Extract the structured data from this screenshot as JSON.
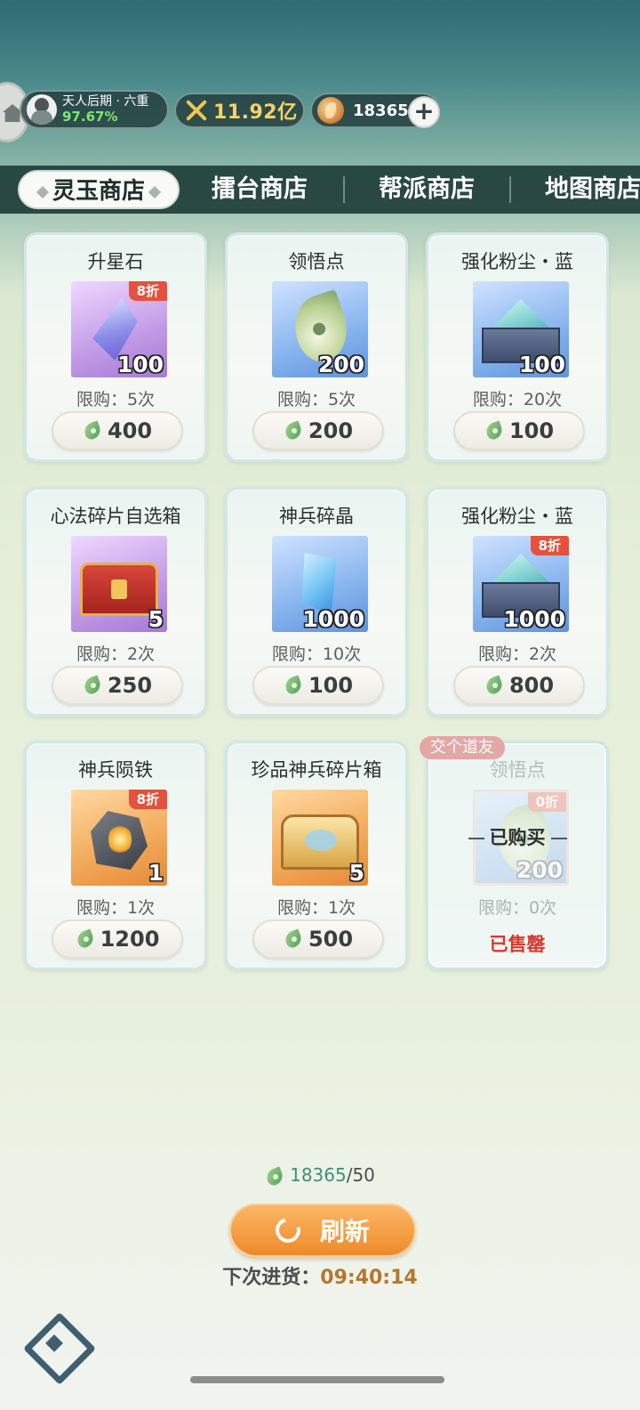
{
  "header": {
    "realm_name": "天人后期 · 六重",
    "realm_progress": "97.67%",
    "power_value": "11.92亿",
    "jade_amount": "18365",
    "add_symbol": "+"
  },
  "tabs": [
    {
      "label": "灵玉商店",
      "active": true
    },
    {
      "label": "擂台商店",
      "active": false
    },
    {
      "label": "帮派商店",
      "active": false
    },
    {
      "label": "地图商店",
      "active": false
    }
  ],
  "items": [
    {
      "name": "升星石",
      "count": "100",
      "discount": "8折",
      "limit": "限购：5次",
      "price": "400",
      "icon": "star-stone-icon",
      "bg": "purple"
    },
    {
      "name": "领悟点",
      "count": "200",
      "discount": "",
      "limit": "限购：5次",
      "price": "200",
      "icon": "insight-jade-icon",
      "bg": "blue"
    },
    {
      "name": "强化粉尘・蓝",
      "count": "100",
      "discount": "",
      "limit": "限购：20次",
      "price": "100",
      "icon": "blue-dust-icon",
      "bg": "blue"
    },
    {
      "name": "心法碎片自选箱",
      "count": "5",
      "discount": "",
      "limit": "限购：2次",
      "price": "250",
      "icon": "treasure-chest-icon",
      "bg": "purple"
    },
    {
      "name": "神兵碎晶",
      "count": "1000",
      "discount": "",
      "limit": "限购：10次",
      "price": "100",
      "icon": "weapon-shard-icon",
      "bg": "blue"
    },
    {
      "name": "强化粉尘・蓝",
      "count": "1000",
      "discount": "8折",
      "limit": "限购：2次",
      "price": "800",
      "icon": "blue-dust-icon",
      "bg": "blue"
    },
    {
      "name": "神兵陨铁",
      "count": "1",
      "discount": "8折",
      "limit": "限购：1次",
      "price": "1200",
      "icon": "meteor-iron-icon",
      "bg": "orange"
    },
    {
      "name": "珍品神兵碎片箱",
      "count": "5",
      "discount": "",
      "limit": "限购：1次",
      "price": "500",
      "icon": "golden-chest-icon",
      "bg": "orange"
    }
  ],
  "sold_item": {
    "tag": "交个道友",
    "name": "领悟点",
    "discount": "0折",
    "purchased_label": "已购买",
    "count": "200",
    "limit": "限购：0次",
    "status": "已售罄"
  },
  "footer": {
    "balance_current": "18365",
    "balance_cost": "/50",
    "refresh_label": "刷新",
    "restock_label": "下次进货：",
    "restock_time": "09:40:14"
  },
  "colors": {
    "accent_orange": "#ee8a2a",
    "discount_red": "#e5513c",
    "soldout_red": "#d9382f",
    "progress_green": "#7de86e"
  }
}
